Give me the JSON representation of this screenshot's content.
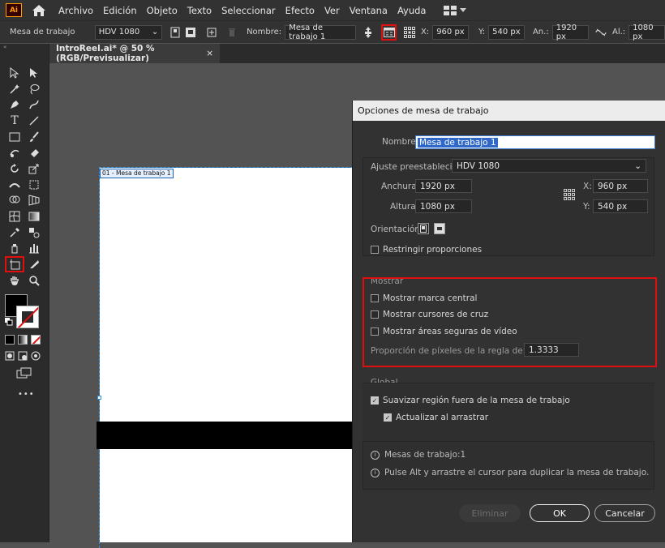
{
  "app": {
    "logo": "Ai",
    "accent": "#ff9a00"
  },
  "menu": [
    "Archivo",
    "Edición",
    "Objeto",
    "Texto",
    "Seleccionar",
    "Efecto",
    "Ver",
    "Ventana",
    "Ayuda"
  ],
  "control": {
    "artboard_label": "Mesa de trabajo",
    "preset": "HDV 1080",
    "name_label": "Nombre:",
    "name_value": "Mesa de trabajo 1",
    "x_label": "X:",
    "x_value": "960 px",
    "y_label": "Y:",
    "y_value": "540 px",
    "w_label": "An.:",
    "w_value": "1920 px",
    "h_label": "Al.:",
    "h_value": "1080 px"
  },
  "tab": {
    "title": "IntroReel.ai* @ 50 % (RGB/Previsualizar)",
    "close": "×"
  },
  "artboard": {
    "label": "01 - Mesa de trabajo 1"
  },
  "dialog": {
    "title": "Opciones de mesa de trabajo",
    "name_label": "Nombre:",
    "name_value": "Mesa de trabajo 1",
    "preset_label": "Ajuste preestablecido:",
    "preset_value": "HDV 1080",
    "width_label": "Anchura:",
    "width_value": "1920 px",
    "height_label": "Altura:",
    "height_value": "1080 px",
    "x_label": "X:",
    "x_value": "960 px",
    "y_label": "Y:",
    "y_value": "540 px",
    "orientation_label": "Orientación:",
    "constrain_label": "Restringir proporciones",
    "show_section": "Mostrar",
    "show_center": "Mostrar marca central",
    "show_cross": "Mostrar cursores de cruz",
    "show_safe": "Mostrar áreas seguras de vídeo",
    "pixel_ratio_label": "Proporción de píxeles de la regla de vídeo:",
    "pixel_ratio_value": "1.3333",
    "global_section": "Global",
    "fade_region": "Suavizar región fuera de la mesa de trabajo",
    "update_drag": "Actualizar al arrastrar",
    "artboards_info": "Mesas de trabajo:1",
    "alt_info": "Pulse Alt y arrastre el cursor para duplicar la mesa de trabajo.",
    "delete_btn": "Eliminar",
    "ok_btn": "OK",
    "cancel_btn": "Cancelar",
    "checks": {
      "constrain": false,
      "center": false,
      "cross": false,
      "safe": false,
      "fade": true,
      "update": true
    }
  },
  "toolbar": {
    "more": "•••"
  }
}
